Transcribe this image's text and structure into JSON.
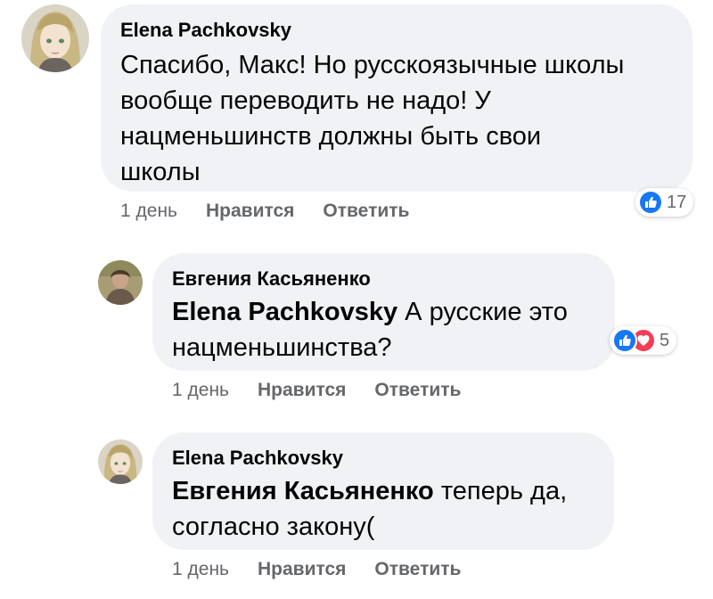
{
  "comments": [
    {
      "author": "Elena Pachkovsky",
      "mention": "",
      "text": "Спасибо, Макс! Но русскоязычные школы вообще переводить не надо! У нацменьшинств должны быть свои школы",
      "lines": [
        "Спасибо, Макс! Но русскоязычные школы",
        "вообще переводить не надо! У",
        "нацменьшинств должны быть свои",
        "школы"
      ],
      "time": "1 день",
      "like_label": "Нравится",
      "reply_label": "Ответить",
      "reaction_count": "17",
      "reaction_icons": [
        "like-icon"
      ]
    },
    {
      "author": "Евгения Касьяненко",
      "mention": "Elena Pachkovsky",
      "line1_rest": " А русские это",
      "line2": "нацменьшинства?",
      "time": "1 день",
      "like_label": "Нравится",
      "reply_label": "Ответить",
      "reaction_count": "5",
      "reaction_icons": [
        "like-icon",
        "love-icon"
      ]
    },
    {
      "author": "Elena Pachkovsky",
      "mention": "Евгения Касьяненко",
      "line1_rest": " теперь да,",
      "line2": "согласно закону(",
      "time": "1 день",
      "like_label": "Нравится",
      "reply_label": "Ответить"
    }
  ],
  "colors": {
    "bubble": "#f0f2f5",
    "meta_text": "#65676b",
    "like_blue": "#1877f2",
    "love_red": "#f33e58"
  }
}
